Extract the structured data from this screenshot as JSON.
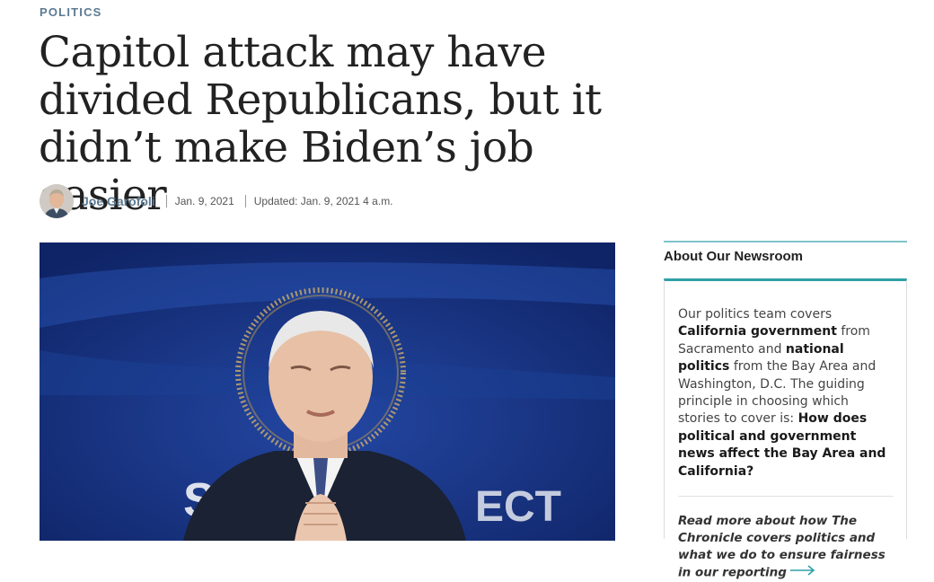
{
  "section": {
    "label": "POLITICS"
  },
  "article": {
    "headline": "Capitol attack may have divided Republicans, but it didn’t make Biden’s job easier",
    "author": "Joe Garofoli",
    "date": "Jan. 9, 2021",
    "updated": "Updated: Jan. 9, 2021 4 a.m."
  },
  "sidebar": {
    "title": "About Our Newsroom",
    "body": {
      "t1": "Our politics team covers ",
      "b1": "California government",
      "t2": " from Sacramento and ",
      "b2": "national politics",
      "t3": " from the Bay Area and Washington, D.C. The guiding principle in choosing which stories to cover is: ",
      "b3": "How does political and government news affect the Bay Area and California?"
    },
    "link_text": "Read more about how The Chronicle covers politics and what we do to ensure fairness in our reporting",
    "link_icon": "arrow-right-icon"
  },
  "colors": {
    "section_label": "#5c7a92",
    "author": "#5c7a92",
    "accent_teal": "#2f9fa6",
    "photo_background": "#16337e"
  }
}
